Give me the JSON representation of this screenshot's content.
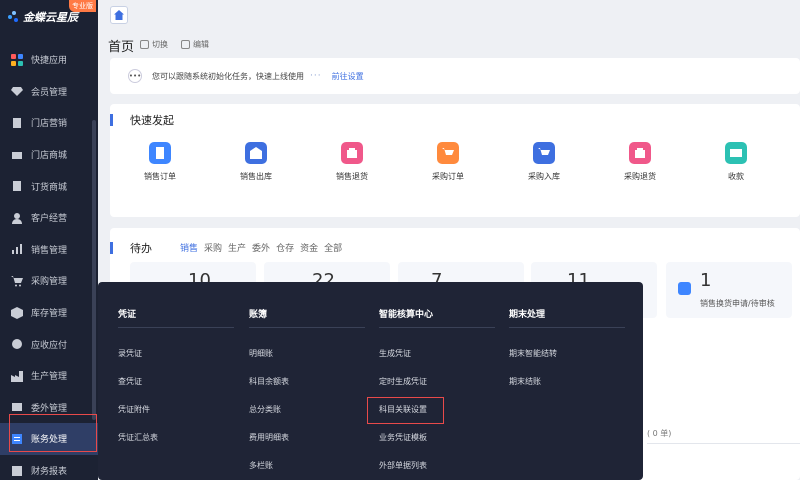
{
  "brand": {
    "name": "金蝶云星辰",
    "badge": "专业版"
  },
  "sidebar": {
    "items": [
      {
        "label": "快捷应用",
        "icon": "apps-icon"
      },
      {
        "label": "会员管理",
        "icon": "diamond-icon"
      },
      {
        "label": "门店营销",
        "icon": "store-icon"
      },
      {
        "label": "门店商城",
        "icon": "mall-icon"
      },
      {
        "label": "订货商城",
        "icon": "order-icon"
      },
      {
        "label": "客户经营",
        "icon": "customer-icon"
      },
      {
        "label": "销售管理",
        "icon": "sales-icon"
      },
      {
        "label": "采购管理",
        "icon": "cart-icon"
      },
      {
        "label": "库存管理",
        "icon": "inventory-icon"
      },
      {
        "label": "应收应付",
        "icon": "payable-icon"
      },
      {
        "label": "生产管理",
        "icon": "factory-icon"
      },
      {
        "label": "委外管理",
        "icon": "outsourcing-icon"
      },
      {
        "label": "账务处理",
        "icon": "ledger-icon",
        "active": true
      },
      {
        "label": "财务报表",
        "icon": "report-icon"
      }
    ]
  },
  "header": {
    "title": "首页",
    "switch_label": "切换",
    "edit_label": "编辑"
  },
  "notice": {
    "text": "您可以跟随系统初始化任务，快速上线使用",
    "dots": "···",
    "link": "前往设置"
  },
  "quick": {
    "title": "快速发起",
    "items": [
      {
        "label": "销售订单",
        "color": "#3e86ff",
        "icon": "doc-icon"
      },
      {
        "label": "销售出库",
        "color": "#3e6fe0",
        "icon": "warehouse-out-icon"
      },
      {
        "label": "销售退货",
        "color": "#f0588a",
        "icon": "return-icon"
      },
      {
        "label": "采购订单",
        "color": "#ff8a3d",
        "icon": "purchase-cart-icon"
      },
      {
        "label": "采购入库",
        "color": "#3e6fe0",
        "icon": "purchase-in-icon"
      },
      {
        "label": "采购退货",
        "color": "#f0588a",
        "icon": "purchase-return-icon"
      },
      {
        "label": "收款",
        "color": "#2cc1b3",
        "icon": "payment-icon"
      }
    ]
  },
  "todo": {
    "title": "待办",
    "tabs": [
      "销售",
      "采购",
      "生产",
      "委外",
      "仓存",
      "资金",
      "全部"
    ],
    "stats": [
      {
        "value": "10"
      },
      {
        "value": "22"
      },
      {
        "value": "7"
      },
      {
        "value": "11"
      },
      {
        "value": "1",
        "label": "销售换货申请/待审核"
      }
    ],
    "zero_text": "( 0 单)"
  },
  "mega_menu": {
    "columns": [
      {
        "head": "凭证",
        "items": [
          "录凭证",
          "查凭证",
          "凭证附件",
          "凭证汇总表"
        ]
      },
      {
        "head": "账簿",
        "items": [
          "明细账",
          "科目余额表",
          "总分类账",
          "费用明细表",
          "多栏账"
        ]
      },
      {
        "head": "智能核算中心",
        "items": [
          "生成凭证",
          "定时生成凭证",
          "科目关联设置",
          "业务凭证模板",
          "外部单据列表"
        ]
      },
      {
        "head": "期末处理",
        "items": [
          "期末智能结转",
          "期末结账"
        ]
      }
    ]
  }
}
